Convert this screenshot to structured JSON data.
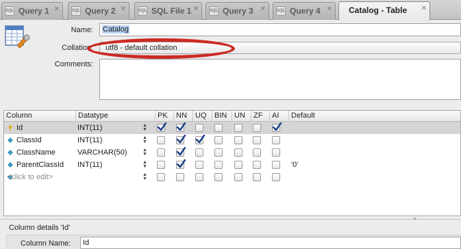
{
  "tabs": [
    {
      "label": "Query 1",
      "icon": "sql-file-icon"
    },
    {
      "label": "Query 2",
      "icon": "sql-file-icon"
    },
    {
      "label": "SQL File 1",
      "icon": "sql-file-icon"
    },
    {
      "label": "Query 3",
      "icon": "sql-file-icon"
    },
    {
      "label": "Query 4",
      "icon": "sql-file-icon"
    },
    {
      "label": "Catalog - Table",
      "active": true
    }
  ],
  "tab_icon_text": "SQL",
  "tab_close": "✕",
  "form": {
    "name_label": "Name:",
    "name_value": "Catalog",
    "collation_label": "Collation:",
    "collation_value": "utf8 - default collation",
    "comments_label": "Comments:",
    "comments_value": ""
  },
  "grid": {
    "headers": [
      "Column",
      "Datatype",
      "PK",
      "NN",
      "UQ",
      "BIN",
      "UN",
      "ZF",
      "AI",
      "Default"
    ],
    "rows": [
      {
        "column": "Id",
        "datatype": "INT(11)",
        "flags": [
          true,
          true,
          false,
          false,
          false,
          false,
          true
        ],
        "default": "",
        "icon": "primary-key-icon",
        "selected": true
      },
      {
        "column": "ClassId",
        "datatype": "INT(11)",
        "flags": [
          false,
          true,
          true,
          false,
          false,
          false,
          false
        ],
        "default": "",
        "icon": "column-diamond-icon"
      },
      {
        "column": "ClassName",
        "datatype": "VARCHAR(50)",
        "flags": [
          false,
          true,
          false,
          false,
          false,
          false,
          false
        ],
        "default": "",
        "icon": "column-diamond-icon"
      },
      {
        "column": "ParentClassId",
        "datatype": "INT(11)",
        "flags": [
          false,
          true,
          false,
          false,
          false,
          false,
          false
        ],
        "default": "'0'",
        "icon": "column-diamond-icon"
      },
      {
        "column": "<click to edit>",
        "datatype": "",
        "flags": [
          false,
          false,
          false,
          false,
          false,
          false,
          false
        ],
        "default": "",
        "icon": "column-diamond-icon",
        "placeholder": true
      }
    ]
  },
  "details": {
    "title": "Column details 'Id'",
    "column_name_label": "Column Name:",
    "column_name_value": "Id"
  },
  "colors": {
    "highlight_ellipse": "#cc2a24",
    "selected_row": "#d5d5d5",
    "checkmark": "#1b3f8a",
    "key_icon": "#e0b020",
    "diamond_icon": "#3aa0c8"
  }
}
